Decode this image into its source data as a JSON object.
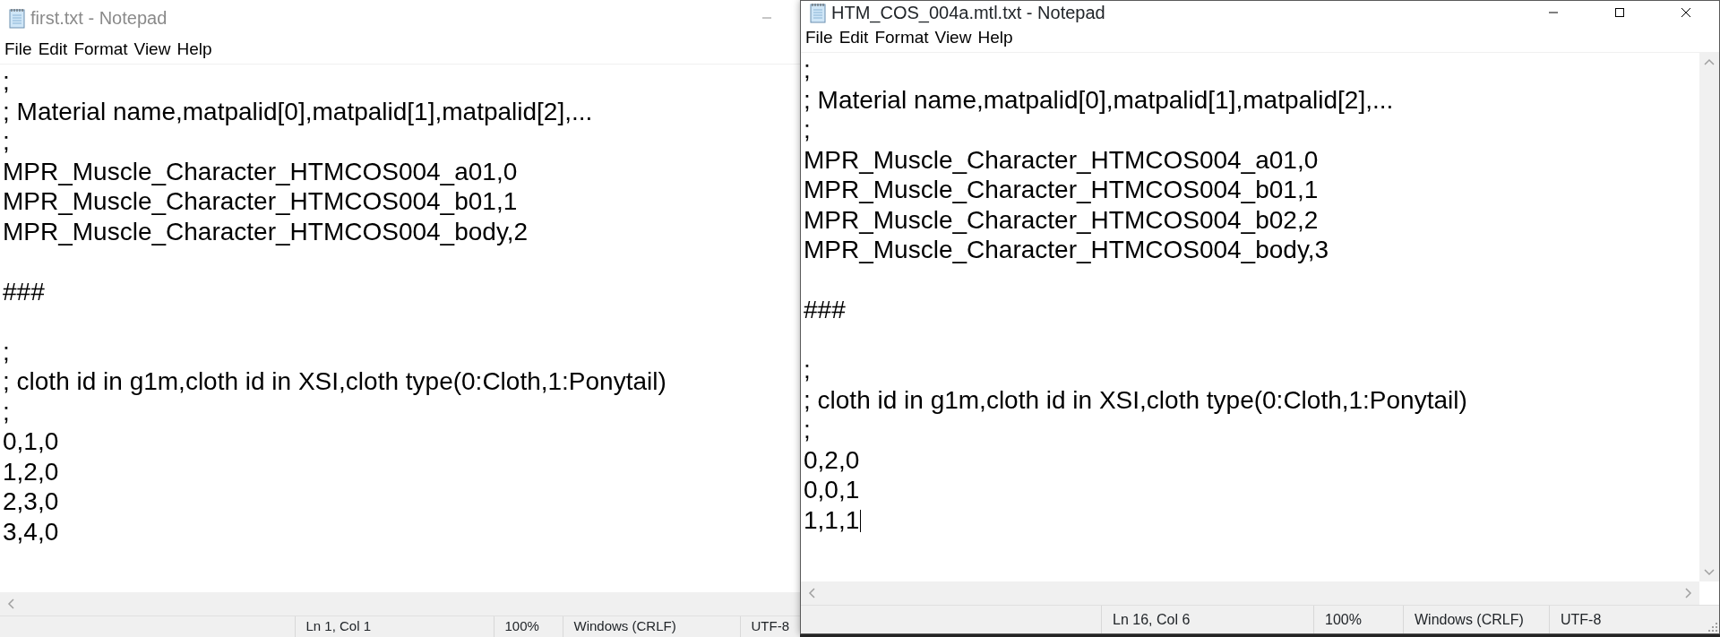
{
  "windows": [
    {
      "title": "first.txt - Notepad",
      "active": false,
      "caption_buttons": [
        {
          "kind": "minimize"
        }
      ],
      "menu": [
        "File",
        "Edit",
        "Format",
        "View",
        "Help"
      ],
      "blocks": [
        [
          ";",
          "; Material name,matpalid[0],matpalid[1],matpalid[2],...",
          ";",
          "MPR_Muscle_Character_HTMCOS004_a01,0",
          "MPR_Muscle_Character_HTMCOS004_b01,1",
          "MPR_Muscle_Character_HTMCOS004_body,2"
        ],
        [
          "###"
        ],
        [
          ";",
          "; cloth id in g1m,cloth id in XSI,cloth type(0:Cloth,1:Ponytail)",
          ";",
          "0,1,0",
          "1,2,0",
          "2,3,0",
          "3,4,0"
        ]
      ],
      "status": {
        "position": "Ln 1, Col 1",
        "zoom": "100%",
        "line_endings": "Windows (CRLF)",
        "encoding": "UTF-8"
      }
    },
    {
      "title": "HTM_COS_004a.mtl.txt - Notepad",
      "active": true,
      "caption_buttons": [
        {
          "kind": "minimize"
        },
        {
          "kind": "maximize"
        },
        {
          "kind": "close"
        }
      ],
      "menu": [
        "File",
        "Edit",
        "Format",
        "View",
        "Help"
      ],
      "blocks": [
        [
          ";",
          "; Material name,matpalid[0],matpalid[1],matpalid[2],...",
          ";",
          "MPR_Muscle_Character_HTMCOS004_a01,0",
          "MPR_Muscle_Character_HTMCOS004_b01,1",
          "MPR_Muscle_Character_HTMCOS004_b02,2",
          "MPR_Muscle_Character_HTMCOS004_body,3"
        ],
        [
          "###"
        ],
        [
          ";",
          "; cloth id in g1m,cloth id in XSI,cloth type(0:Cloth,1:Ponytail)",
          ";",
          "0,2,0",
          "0,0,1",
          "1,1,1"
        ]
      ],
      "caret_after_last_line": true,
      "status": {
        "position": "Ln 16, Col 6",
        "zoom": "100%",
        "line_endings": "Windows (CRLF)",
        "encoding": "UTF-8"
      }
    }
  ]
}
